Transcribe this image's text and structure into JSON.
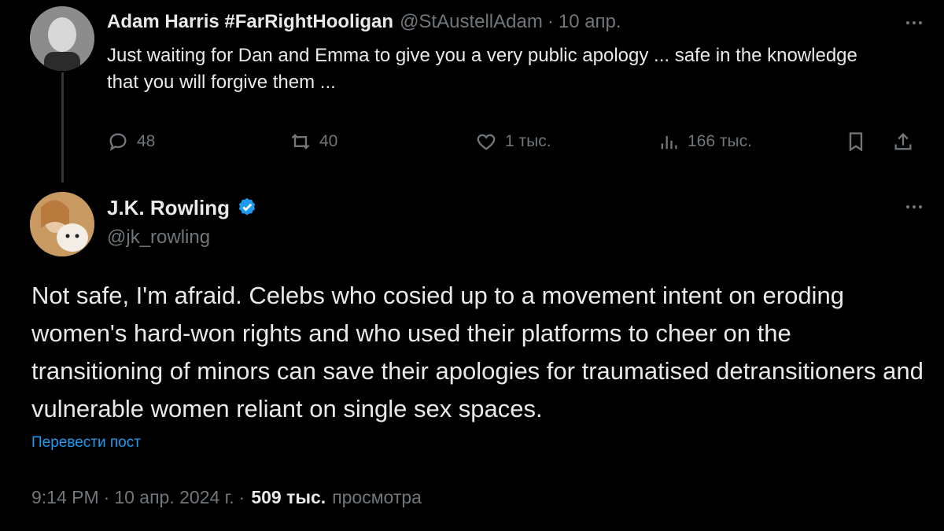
{
  "reply": {
    "author_name": "Adam Harris #FarRightHooligan",
    "handle": "@StAustellAdam",
    "separator": "·",
    "date": "10 апр.",
    "text": "Just waiting for Dan and Emma to give you a very public apology ... safe in the knowledge that you will forgive them ...",
    "actions": {
      "replies": "48",
      "reposts": "40",
      "likes": "1 тыс.",
      "views": "166 тыс."
    }
  },
  "main": {
    "author_name": "J.K. Rowling",
    "handle": "@jk_rowling",
    "text": "Not safe, I'm afraid. Celebs who cosied up to a movement intent on eroding women's hard-won rights and who used their platforms to cheer on the transitioning of minors can save their apologies for traumatised detransitioners and vulnerable women reliant on single sex spaces.",
    "translate_link": "Перевести пост",
    "time": "9:14 PM",
    "date": "10 апр. 2024 г.",
    "views_count": "509 тыс.",
    "views_label": "просмотра"
  },
  "colors": {
    "background": "#000000",
    "text": "#e7e9ea",
    "muted": "#71767b",
    "accent": "#1d9bf0"
  },
  "icons": [
    "reply-icon",
    "repost-icon",
    "like-icon",
    "views-icon",
    "bookmark-icon",
    "share-icon",
    "more-icon",
    "verified-badge-icon"
  ]
}
